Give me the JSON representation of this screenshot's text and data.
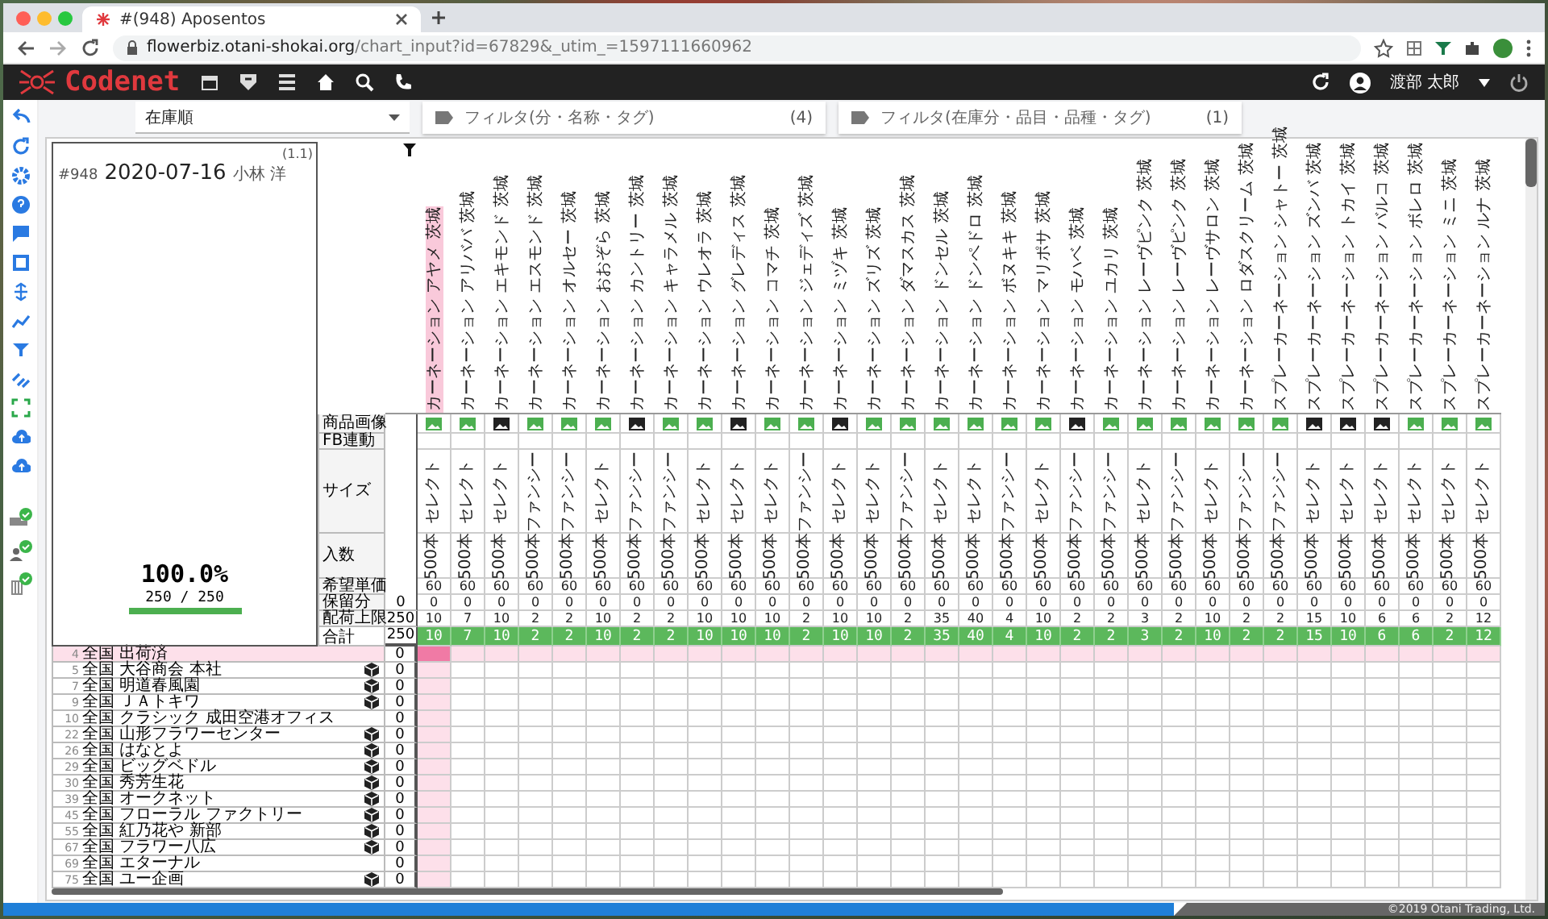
{
  "browser": {
    "tab_title": "#(948) Aposentos",
    "url_host": "flowerbiz.otani-shokai.org",
    "url_path": "/chart_input?id=67829&_utim_=1597111660962"
  },
  "app": {
    "logo": "Codenet",
    "user": "渡部 太郎"
  },
  "sort": {
    "value": "在庫順"
  },
  "filters": [
    {
      "placeholder": "フィルタ(分・名称・タグ)",
      "count": "(4)"
    },
    {
      "placeholder": "フィルタ(在庫分・品目・品種・タグ)",
      "count": "(1)"
    }
  ],
  "order": {
    "number": "#948",
    "date": "2020-07-16",
    "person": "小林 洋",
    "corner": "(1.1)",
    "percent": "100.0%",
    "ratio": "250 / 250",
    "level": 1
  },
  "attribute_labels": [
    {
      "label": "商品画像"
    },
    {
      "label": "FB連動"
    },
    {
      "label": "サイズ"
    },
    {
      "label": "入数"
    },
    {
      "label": "希望単価"
    },
    {
      "label": "保留分",
      "value": "0"
    },
    {
      "label": "配荷上限",
      "value": "250"
    },
    {
      "label": "合計",
      "value": "250"
    }
  ],
  "items": [
    {
      "name": "カーネーション アヤメ 茨城",
      "selected": true,
      "has_photo": true,
      "size": "セレクト",
      "count": "500本",
      "price": "60",
      "reserved": "0",
      "limit": "10",
      "total": "10"
    },
    {
      "name": "カーネーション アリババ 茨城",
      "selected": false,
      "has_photo": true,
      "size": "セレクト",
      "count": "500本",
      "price": "60",
      "reserved": "0",
      "limit": "7",
      "total": "7"
    },
    {
      "name": "カーネーション エキモンド 茨城",
      "selected": false,
      "has_photo": false,
      "size": "セレクト",
      "count": "500本",
      "price": "60",
      "reserved": "0",
      "limit": "10",
      "total": "10"
    },
    {
      "name": "カーネーション エスモンド 茨城",
      "selected": false,
      "has_photo": true,
      "size": "ファンシー",
      "count": "500本",
      "price": "60",
      "reserved": "0",
      "limit": "2",
      "total": "2"
    },
    {
      "name": "カーネーション オルセー 茨城",
      "selected": false,
      "has_photo": true,
      "size": "ファンシー",
      "count": "500本",
      "price": "60",
      "reserved": "0",
      "limit": "2",
      "total": "2"
    },
    {
      "name": "カーネーション おおぞら 茨城",
      "selected": false,
      "has_photo": true,
      "size": "セレクト",
      "count": "500本",
      "price": "60",
      "reserved": "0",
      "limit": "10",
      "total": "10"
    },
    {
      "name": "カーネーション カントリー 茨城",
      "selected": false,
      "has_photo": false,
      "size": "ファンシー",
      "count": "500本",
      "price": "60",
      "reserved": "0",
      "limit": "2",
      "total": "2"
    },
    {
      "name": "カーネーション キャラメル 茨城",
      "selected": false,
      "has_photo": true,
      "size": "ファンシー",
      "count": "500本",
      "price": "60",
      "reserved": "0",
      "limit": "2",
      "total": "2"
    },
    {
      "name": "カーネーション ウレオラ 茨城",
      "selected": false,
      "has_photo": true,
      "size": "セレクト",
      "count": "500本",
      "price": "60",
      "reserved": "0",
      "limit": "10",
      "total": "10"
    },
    {
      "name": "カーネーション グレディス 茨城",
      "selected": false,
      "has_photo": false,
      "size": "セレクト",
      "count": "500本",
      "price": "60",
      "reserved": "0",
      "limit": "10",
      "total": "10"
    },
    {
      "name": "カーネーション コマチ 茨城",
      "selected": false,
      "has_photo": true,
      "size": "セレクト",
      "count": "500本",
      "price": "60",
      "reserved": "0",
      "limit": "10",
      "total": "10"
    },
    {
      "name": "カーネーション ジェディズ 茨城",
      "selected": false,
      "has_photo": true,
      "size": "ファンシー",
      "count": "500本",
      "price": "60",
      "reserved": "0",
      "limit": "2",
      "total": "2"
    },
    {
      "name": "カーネーション ミヅキ 茨城",
      "selected": false,
      "has_photo": false,
      "size": "セレクト",
      "count": "500本",
      "price": "60",
      "reserved": "0",
      "limit": "10",
      "total": "10"
    },
    {
      "name": "カーネーション ズリズ 茨城",
      "selected": false,
      "has_photo": true,
      "size": "セレクト",
      "count": "500本",
      "price": "60",
      "reserved": "0",
      "limit": "10",
      "total": "10"
    },
    {
      "name": "カーネーション ダマスカス 茨城",
      "selected": false,
      "has_photo": true,
      "size": "ファンシー",
      "count": "500本",
      "price": "60",
      "reserved": "0",
      "limit": "2",
      "total": "2"
    },
    {
      "name": "カーネーション ドンセル 茨城",
      "selected": false,
      "has_photo": true,
      "size": "セレクト",
      "count": "500本",
      "price": "60",
      "reserved": "0",
      "limit": "35",
      "total": "35"
    },
    {
      "name": "カーネーション ドンペドロ 茨城",
      "selected": false,
      "has_photo": true,
      "size": "セレクト",
      "count": "500本",
      "price": "60",
      "reserved": "0",
      "limit": "40",
      "total": "40"
    },
    {
      "name": "カーネーション ボヌキキ 茨城",
      "selected": false,
      "has_photo": true,
      "size": "ファンシー",
      "count": "500本",
      "price": "60",
      "reserved": "0",
      "limit": "4",
      "total": "4"
    },
    {
      "name": "カーネーション マリポサ 茨城",
      "selected": false,
      "has_photo": true,
      "size": "セレクト",
      "count": "500本",
      "price": "60",
      "reserved": "0",
      "limit": "10",
      "total": "10"
    },
    {
      "name": "カーネーション モハベ 茨城",
      "selected": false,
      "has_photo": false,
      "size": "ファンシー",
      "count": "500本",
      "price": "60",
      "reserved": "0",
      "limit": "2",
      "total": "2"
    },
    {
      "name": "カーネーション ユカリ 茨城",
      "selected": false,
      "has_photo": true,
      "size": "ファンシー",
      "count": "500本",
      "price": "60",
      "reserved": "0",
      "limit": "2",
      "total": "2"
    },
    {
      "name": "カーネーション レーヴピンク 茨城",
      "selected": false,
      "has_photo": true,
      "size": "セレクト",
      "count": "500本",
      "price": "60",
      "reserved": "0",
      "limit": "3",
      "total": "3"
    },
    {
      "name": "カーネーション レーヴピンク 茨城",
      "selected": false,
      "has_photo": true,
      "size": "ファンシー",
      "count": "500本",
      "price": "60",
      "reserved": "0",
      "limit": "2",
      "total": "2"
    },
    {
      "name": "カーネーション レーヴサロン 茨城",
      "selected": false,
      "has_photo": true,
      "size": "セレクト",
      "count": "500本",
      "price": "60",
      "reserved": "0",
      "limit": "10",
      "total": "10"
    },
    {
      "name": "カーネーション ロダスクリーム 茨城",
      "selected": false,
      "has_photo": true,
      "size": "ファンシー",
      "count": "500本",
      "price": "60",
      "reserved": "0",
      "limit": "2",
      "total": "2"
    },
    {
      "name": "スプレーカーネーション シャトー 茨城",
      "selected": false,
      "has_photo": true,
      "size": "ファンシー",
      "count": "500本",
      "price": "60",
      "reserved": "0",
      "limit": "2",
      "total": "2"
    },
    {
      "name": "スプレーカーネーション ズンバ 茨城",
      "selected": false,
      "has_photo": false,
      "size": "セレクト",
      "count": "500本",
      "price": "60",
      "reserved": "0",
      "limit": "15",
      "total": "15"
    },
    {
      "name": "スプレーカーネーション トカイ 茨城",
      "selected": false,
      "has_photo": false,
      "size": "セレクト",
      "count": "500本",
      "price": "60",
      "reserved": "0",
      "limit": "10",
      "total": "10"
    },
    {
      "name": "スプレーカーネーション バルコ 茨城",
      "selected": false,
      "has_photo": false,
      "size": "セレクト",
      "count": "500本",
      "price": "60",
      "reserved": "0",
      "limit": "6",
      "total": "6"
    },
    {
      "name": "スプレーカーネーション ボレロ 茨城",
      "selected": false,
      "has_photo": true,
      "size": "セレクト",
      "count": "500本",
      "price": "60",
      "reserved": "0",
      "limit": "6",
      "total": "6"
    },
    {
      "name": "スプレーカーネーション ミニ 茨城",
      "selected": false,
      "has_photo": true,
      "size": "セレクト",
      "count": "500本",
      "price": "60",
      "reserved": "0",
      "limit": "2",
      "total": "2"
    },
    {
      "name": "スプレーカーネーション ルナ 茨城",
      "selected": false,
      "has_photo": true,
      "size": "セレクト",
      "count": "500本",
      "price": "60",
      "reserved": "0",
      "limit": "12",
      "total": "12"
    }
  ],
  "rows": [
    {
      "number": "4",
      "name": "全国 出荷済",
      "box": false,
      "total": "0",
      "selected": true
    },
    {
      "number": "5",
      "name": "全国 大谷商会 本社",
      "box": true,
      "total": "0",
      "selected": false
    },
    {
      "number": "7",
      "name": "全国 明道春風園",
      "box": true,
      "total": "0",
      "selected": false
    },
    {
      "number": "9",
      "name": "全国 ＪＡトキワ",
      "box": true,
      "total": "0",
      "selected": false
    },
    {
      "number": "10",
      "name": "全国 クラシック 成田空港オフィス",
      "box": false,
      "total": "0",
      "selected": false
    },
    {
      "number": "22",
      "name": "全国 山形フラワーセンター",
      "box": true,
      "total": "0",
      "selected": false
    },
    {
      "number": "26",
      "name": "全国 はなとよ",
      "box": true,
      "total": "0",
      "selected": false
    },
    {
      "number": "29",
      "name": "全国 ビッグベドル",
      "box": true,
      "total": "0",
      "selected": false
    },
    {
      "number": "30",
      "name": "全国 秀芳生花",
      "box": true,
      "total": "0",
      "selected": false
    },
    {
      "number": "39",
      "name": "全国 オークネット",
      "box": true,
      "total": "0",
      "selected": false
    },
    {
      "number": "45",
      "name": "全国 フローラル ファクトリー",
      "box": true,
      "total": "0",
      "selected": false
    },
    {
      "number": "55",
      "name": "全国 紅乃花や 新部",
      "box": true,
      "total": "0",
      "selected": false
    },
    {
      "number": "67",
      "name": "全国 フラワー八広",
      "box": true,
      "total": "0",
      "selected": false
    },
    {
      "number": "69",
      "name": "全国 エターナル",
      "box": false,
      "total": "0",
      "selected": false
    },
    {
      "number": "75",
      "name": "全国 ユー企画",
      "box": true,
      "total": "0",
      "selected": false
    }
  ],
  "footer": {
    "copyright": "©2019 Otani Trading, Ltd."
  }
}
